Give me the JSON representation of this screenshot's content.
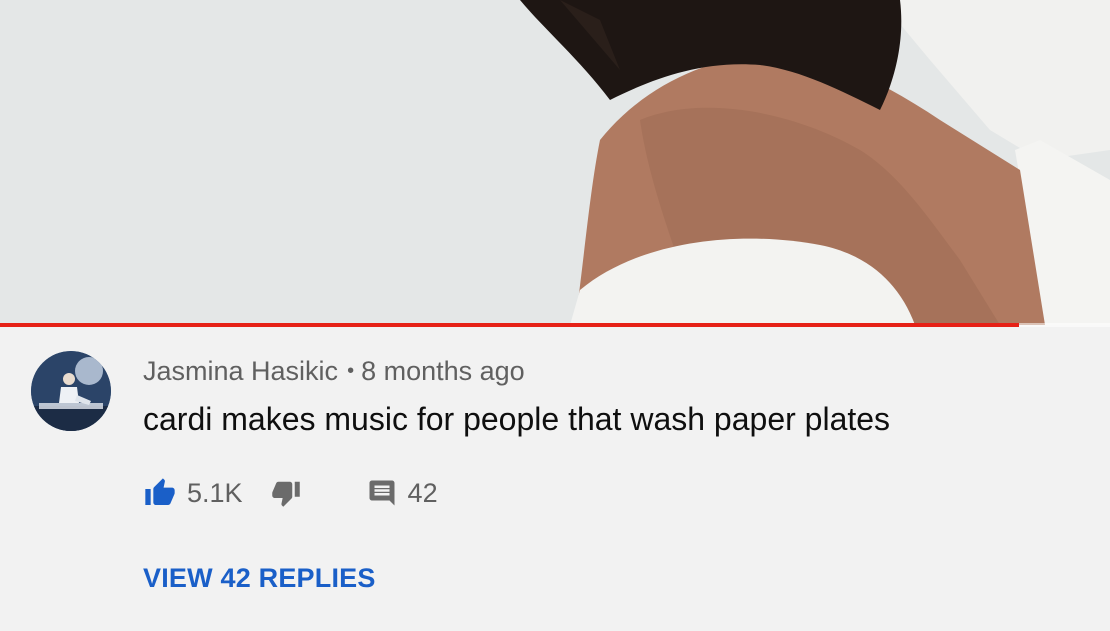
{
  "video": {
    "progress_fraction": 0.918,
    "progress_color": "#e62117"
  },
  "comment": {
    "author": "Jasmina Hasikic",
    "separator": "•",
    "time_ago": "8 months ago",
    "text": "cardi makes music for people that wash paper plates",
    "like_count": "5.1K",
    "reply_count": "42",
    "view_replies_label": "VIEW 42 REPLIES",
    "like_color": "#1a5fc8",
    "link_color": "#1a5fc8",
    "icons": {
      "like": "thumbs-up-icon",
      "dislike": "thumbs-down-icon",
      "reply": "comment-icon"
    }
  }
}
